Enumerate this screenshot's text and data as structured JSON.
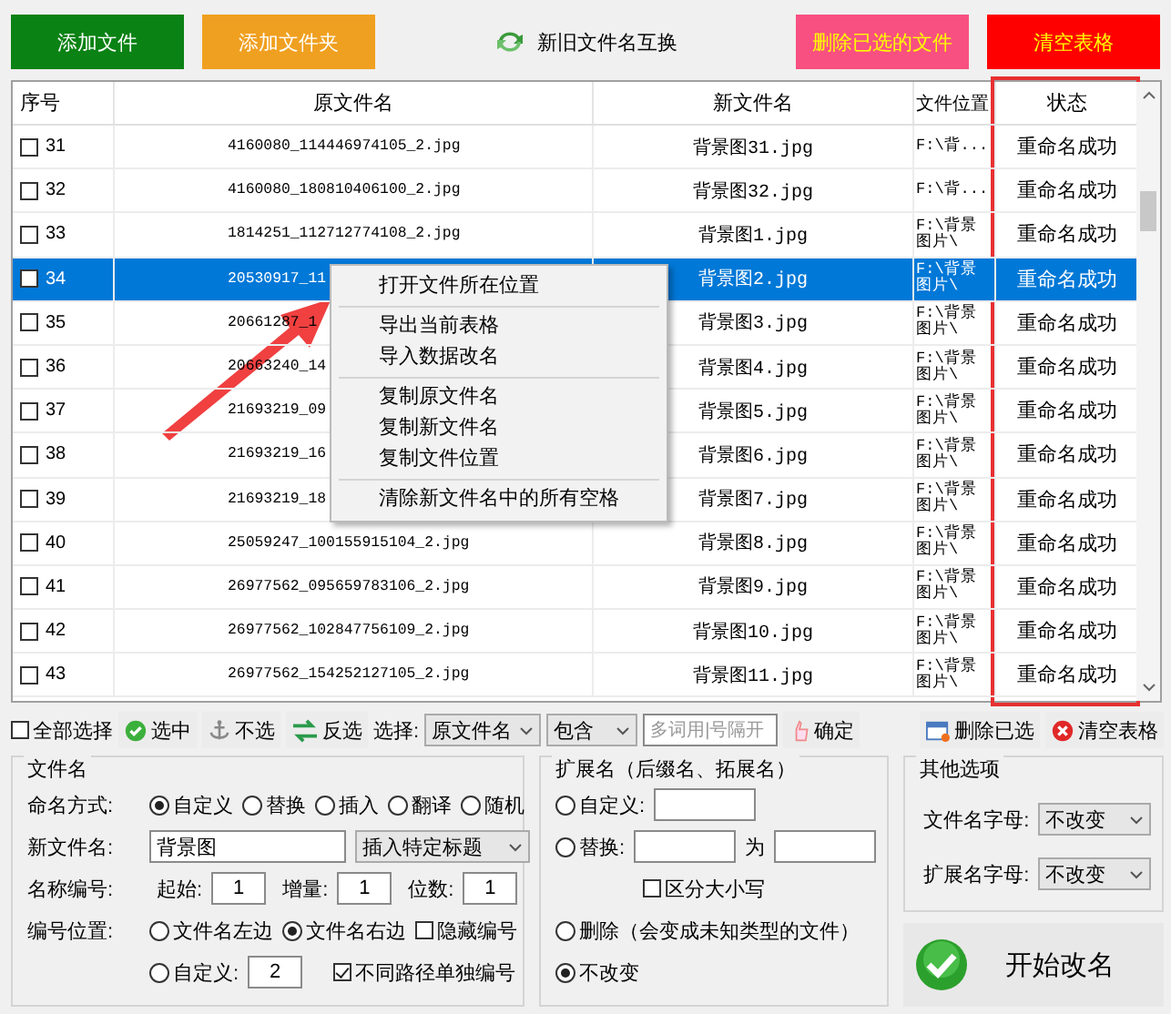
{
  "top_buttons": [
    {
      "label": "添加文件",
      "kind": "light",
      "color": "#0a8214"
    },
    {
      "label": "添加文件夹",
      "kind": "light",
      "color": "#f0a020"
    },
    {
      "label": "新旧文件名互换",
      "kind": "icon",
      "color": "#f0f0f0"
    },
    {
      "label": "删除已选的文件",
      "kind": "warm",
      "color": "#f85080"
    },
    {
      "label": "清空表格",
      "kind": "warm",
      "color": "#ff0000"
    }
  ],
  "table": {
    "columns": [
      "序号",
      "原文件名",
      "新文件名",
      "文件位置",
      "状态"
    ],
    "rows": [
      {
        "checked": false,
        "selected": false,
        "seq": "31",
        "original": "4160080_114446974105_2.jpg",
        "new": "背景图31.jpg",
        "location": "F:\\背...",
        "status": "重命名成功"
      },
      {
        "checked": false,
        "selected": false,
        "seq": "32",
        "original": "4160080_180810406100_2.jpg",
        "new": "背景图32.jpg",
        "location": "F:\\背...",
        "status": "重命名成功"
      },
      {
        "checked": false,
        "selected": false,
        "seq": "33",
        "original": "1814251_112712774108_2.jpg",
        "new": "背景图1.jpg",
        "location": "F:\\背景图片\\",
        "status": "重命名成功"
      },
      {
        "checked": false,
        "selected": true,
        "seq": "34",
        "original": "20530917_11",
        "new": "背景图2.jpg",
        "location": "F:\\背景图片\\",
        "status": "重命名成功"
      },
      {
        "checked": false,
        "selected": false,
        "seq": "35",
        "original": "20661287_1",
        "new": "背景图3.jpg",
        "location": "F:\\背景图片\\",
        "status": "重命名成功"
      },
      {
        "checked": false,
        "selected": false,
        "seq": "36",
        "original": "20663240_14",
        "new": "背景图4.jpg",
        "location": "F:\\背景图片\\",
        "status": "重命名成功"
      },
      {
        "checked": false,
        "selected": false,
        "seq": "37",
        "original": "21693219_09",
        "new": "背景图5.jpg",
        "location": "F:\\背景图片\\",
        "status": "重命名成功"
      },
      {
        "checked": false,
        "selected": false,
        "seq": "38",
        "original": "21693219_16",
        "new": "背景图6.jpg",
        "location": "F:\\背景图片\\",
        "status": "重命名成功"
      },
      {
        "checked": false,
        "selected": false,
        "seq": "39",
        "original": "21693219_18",
        "new": "背景图7.jpg",
        "location": "F:\\背景图片\\",
        "status": "重命名成功"
      },
      {
        "checked": false,
        "selected": false,
        "seq": "40",
        "original": "25059247_100155915104_2.jpg",
        "new": "背景图8.jpg",
        "location": "F:\\背景图片\\",
        "status": "重命名成功"
      },
      {
        "checked": false,
        "selected": false,
        "seq": "41",
        "original": "26977562_095659783106_2.jpg",
        "new": "背景图9.jpg",
        "location": "F:\\背景图片\\",
        "status": "重命名成功"
      },
      {
        "checked": false,
        "selected": false,
        "seq": "42",
        "original": "26977562_102847756109_2.jpg",
        "new": "背景图10.jpg",
        "location": "F:\\背景图片\\",
        "status": "重命名成功"
      },
      {
        "checked": false,
        "selected": false,
        "seq": "43",
        "original": "26977562_154252127105_2.jpg",
        "new": "背景图11.jpg",
        "location": "F:\\背景图片\\",
        "status": "重命名成功"
      }
    ]
  },
  "context_menu": [
    [
      "打开文件所在位置"
    ],
    [
      "导出当前表格",
      "导入数据改名"
    ],
    [
      "复制原文件名",
      "复制新文件名",
      "复制文件位置"
    ],
    [
      "清除新文件名中的所有空格"
    ]
  ],
  "filter_bar": {
    "select_all": {
      "label": "全部选择",
      "checked": false
    },
    "buttons": [
      {
        "label": "选中",
        "kind": "check"
      },
      {
        "label": "不选",
        "kind": "anchor"
      },
      {
        "label": "反选",
        "kind": "swap"
      }
    ],
    "select_label": "选择:",
    "field": "原文件名",
    "match": "包含",
    "placeholder": "多词用|号隔开",
    "confirm": "确定",
    "right_buttons": [
      {
        "label": "删除已选",
        "kind": "window"
      },
      {
        "label": "清空表格",
        "kind": "close"
      }
    ]
  },
  "filename_group": {
    "title": "文件名",
    "mode_label": "命名方式:",
    "modes": [
      {
        "label": "自定义",
        "selected": true
      },
      {
        "label": "替换",
        "selected": false
      },
      {
        "label": "插入",
        "selected": false
      },
      {
        "label": "翻译",
        "selected": false
      },
      {
        "label": "随机",
        "selected": false
      }
    ],
    "new_name_label": "新文件名:",
    "new_name": "背景图",
    "insert_title": "插入特定标题",
    "number_label": "名称编号:",
    "number_fields": [
      {
        "label": "起始:",
        "value": "1"
      },
      {
        "label": "增量:",
        "value": "1"
      },
      {
        "label": "位数:",
        "value": "1"
      }
    ],
    "position_label": "编号位置:",
    "positions": [
      {
        "label": "文件名左边",
        "selected": false
      },
      {
        "label": "文件名右边",
        "selected": true
      }
    ],
    "hide_number": {
      "label": "隐藏编号",
      "checked": false
    },
    "custom_position": {
      "label": "自定义:",
      "selected": false,
      "value": "2"
    },
    "separate_paths": {
      "label": "不同路径单独编号",
      "checked": true
    }
  },
  "extension_group": {
    "title": "扩展名（后缀名、拓展名）",
    "custom": {
      "label": "自定义:",
      "selected": false
    },
    "replace": {
      "label": "替换:",
      "selected": false,
      "to": "为"
    },
    "case_sensitive": {
      "label": "区分大小写",
      "checked": false
    },
    "delete": {
      "label": "删除（会变成未知类型的文件）",
      "selected": false
    },
    "keep": {
      "label": "不改变",
      "selected": true
    }
  },
  "other_group": {
    "title": "其他选项",
    "fields": [
      {
        "label": "文件名字母:",
        "value": "不改变"
      },
      {
        "label": "扩展名字母:",
        "value": "不改变"
      }
    ]
  },
  "start_button": "开始改名"
}
